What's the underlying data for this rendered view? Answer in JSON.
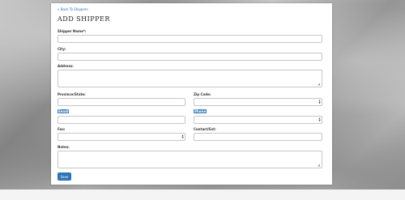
{
  "nav": {
    "back_link": "« Back To Shippers"
  },
  "page": {
    "title": "ADD SHIPPER"
  },
  "form": {
    "shipper_name": {
      "label": "Shipper Name*:",
      "value": ""
    },
    "city": {
      "label": "City:",
      "value": ""
    },
    "address": {
      "label": "Address:",
      "value": ""
    },
    "province_state": {
      "label": "Province/State:",
      "value": ""
    },
    "zip_code": {
      "label": "Zip Code:",
      "value": ""
    },
    "email": {
      "label": "Email",
      "value": ""
    },
    "phone": {
      "label": "Phone",
      "value": ""
    },
    "fax": {
      "label": "Fax:",
      "value": ""
    },
    "contact_ext": {
      "label": "Contact/Ext:",
      "value": ""
    },
    "notes": {
      "label": "Notes:",
      "value": ""
    },
    "save_label": "Save"
  },
  "colors": {
    "accent": "#2e74b5",
    "highlight": "#3b82c4",
    "link": "#2a6ebb"
  },
  "icons": {
    "spinner": "up-down-arrows-icon",
    "resize": "resize-grip-icon"
  }
}
